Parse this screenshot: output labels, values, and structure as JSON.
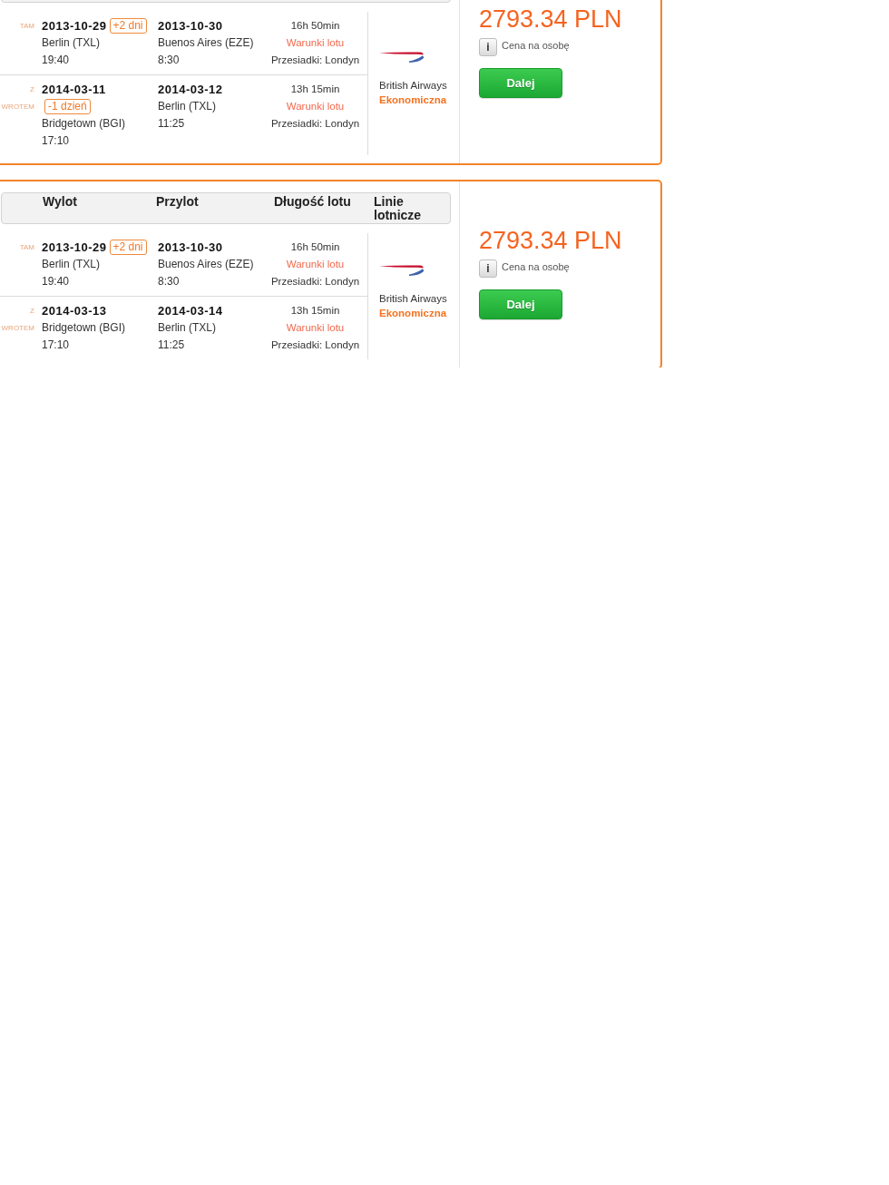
{
  "results": [
    {
      "legs": [
        {
          "direction": "TAM",
          "depart_date": "2013-10-29",
          "day_shift": "+2 dni",
          "depart_city": "Berlin (TXL)",
          "depart_time": "19:40",
          "arrive_date": "2013-10-30",
          "arrive_city": "Buenos Aires (EZE)",
          "arrive_time": "8:30",
          "duration": "16h 50min",
          "conditions_link": "Warunki lotu",
          "stopovers": "Przesiadki: Londyn"
        },
        {
          "direction": "Z WROTEM",
          "depart_date": "2014-03-11",
          "day_shift": "-1 dzień",
          "depart_city": "Bridgetown (BGI)",
          "depart_time": "17:10",
          "arrive_date": "2014-03-12",
          "arrive_city": "Berlin (TXL)",
          "arrive_time": "11:25",
          "duration": "13h 15min",
          "conditions_link": "Warunki lotu",
          "stopovers": "Przesiadki: Londyn"
        }
      ],
      "airline": {
        "name": "British Airways",
        "cabin_class": "Ekonomiczna"
      },
      "price": "2793.34 PLN",
      "info_button": "i",
      "price_note": "Cena na osobę",
      "next_button": "Dalej"
    },
    {
      "columns": [
        "Wylot",
        "Przylot",
        "Długość lotu",
        "Linie lotnicze"
      ],
      "legs": [
        {
          "direction": "TAM",
          "depart_date": "2013-10-29",
          "day_shift": "+2 dni",
          "depart_city": "Berlin (TXL)",
          "depart_time": "19:40",
          "arrive_date": "2013-10-30",
          "arrive_city": "Buenos Aires (EZE)",
          "arrive_time": "8:30",
          "duration": "16h 50min",
          "conditions_link": "Warunki lotu",
          "stopovers": "Przesiadki: Londyn"
        },
        {
          "direction": "Z WROTEM",
          "depart_date": "2014-03-13",
          "depart_city": "Bridgetown (BGI)",
          "depart_time": "17:10",
          "arrive_date": "2014-03-14",
          "arrive_city": "Berlin (TXL)",
          "arrive_time": "11:25",
          "duration": "13h 15min",
          "conditions_link": "Warunki lotu",
          "stopovers": "Przesiadki: Londyn"
        }
      ],
      "airline": {
        "name": "British Airways",
        "cabin_class": "Ekonomiczna"
      },
      "price": "2793.34 PLN",
      "info_button": "i",
      "price_note": "Cena na osobę",
      "next_button": "Dalej"
    }
  ]
}
